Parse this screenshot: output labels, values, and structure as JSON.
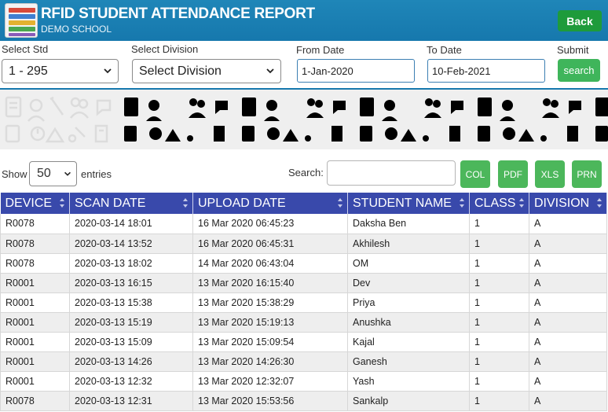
{
  "header": {
    "title": "RFID STUDENT ATTENDANCE REPORT",
    "subtitle": "DEMO SCHOOL",
    "back_label": "Back",
    "accent_color": "#1678ad"
  },
  "filters": {
    "std_label": "Select Std",
    "std_value": "1 - 295",
    "division_label": "Select Division",
    "division_value": "Select Division",
    "from_label": "From Date",
    "from_value": "1-Jan-2020",
    "to_label": "To Date",
    "to_value": "10-Feb-2021",
    "submit_label": "Submit",
    "search_button": "search"
  },
  "table_controls": {
    "show_label": "Show",
    "entries_value": "50",
    "entries_label": "entries",
    "search_label": "Search:",
    "export_buttons": [
      "COL",
      "PDF",
      "XLS",
      "PRN"
    ]
  },
  "table": {
    "columns": [
      "DEVICE",
      "SCAN DATE",
      "UPLOAD DATE",
      "STUDENT NAME",
      "CLASS",
      "DIVISION"
    ],
    "rows": [
      [
        "R0078",
        "2020-03-14 18:01",
        "16 Mar 2020 06:45:23",
        "Daksha Ben",
        "1",
        "A"
      ],
      [
        "R0078",
        "2020-03-14 13:52",
        "16 Mar 2020 06:45:31",
        "Akhilesh",
        "1",
        "A"
      ],
      [
        "R0078",
        "2020-03-13 18:02",
        "14 Mar 2020 06:43:04",
        "OM",
        "1",
        "A"
      ],
      [
        "R0001",
        "2020-03-13 16:15",
        "13 Mar 2020 16:15:40",
        "Dev",
        "1",
        "A"
      ],
      [
        "R0001",
        "2020-03-13 15:38",
        "13 Mar 2020 15:38:29",
        "Priya",
        "1",
        "A"
      ],
      [
        "R0001",
        "2020-03-13 15:19",
        "13 Mar 2020 15:19:13",
        "Anushka",
        "1",
        "A"
      ],
      [
        "R0001",
        "2020-03-13 15:09",
        "13 Mar 2020 15:09:54",
        "Kajal",
        "1",
        "A"
      ],
      [
        "R0001",
        "2020-03-13 14:26",
        "13 Mar 2020 14:26:30",
        "Ganesh",
        "1",
        "A"
      ],
      [
        "R0001",
        "2020-03-13 12:32",
        "13 Mar 2020 12:32:07",
        "Yash",
        "1",
        "A"
      ],
      [
        "R0078",
        "2020-03-13 12:31",
        "13 Mar 2020 15:53:56",
        "Sankalp",
        "1",
        "A"
      ]
    ]
  }
}
